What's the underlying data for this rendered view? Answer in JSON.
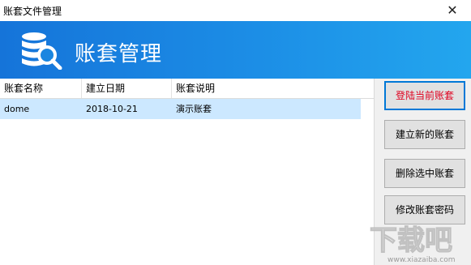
{
  "window": {
    "title": "账套文件管理",
    "close_glyph": "✕"
  },
  "banner": {
    "title": "账套管理",
    "icon": "database-search-icon",
    "color_start": "#1574d9",
    "color_end": "#23a6ee"
  },
  "table": {
    "columns": [
      "账套名称",
      "建立日期",
      "账套说明"
    ],
    "rows": [
      {
        "name": "dome",
        "date": "2018-10-21",
        "desc": "演示账套",
        "selected": true
      }
    ]
  },
  "buttons": {
    "login": "登陆当前账套",
    "create": "建立新的账套",
    "delete": "删除选中账套",
    "change_password": "修改账套密码"
  },
  "watermark": {
    "text": "下载吧",
    "url": "www.xiazaiba.com"
  }
}
